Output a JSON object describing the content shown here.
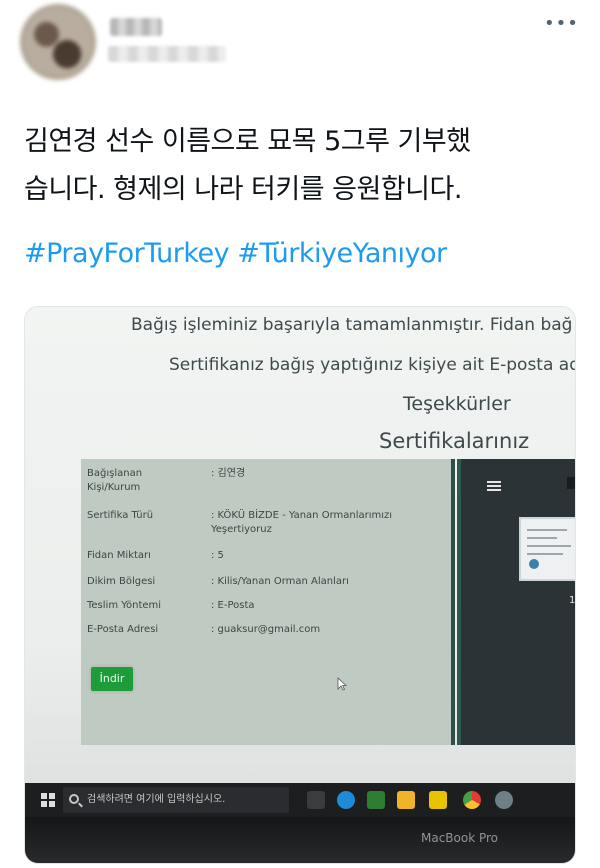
{
  "tweet": {
    "more_icon": "more-options-icon",
    "text_line1": "김연경 선수 이름으로 묘목 5그루 기부했",
    "text_line2": "습니다. 형제의 나라 터키를 응원합니다.",
    "hashtags": [
      "#PrayForTurkey",
      "#TürkiyeYanıyor"
    ]
  },
  "photo": {
    "screen_lines": [
      "Bağış işleminiz başarıyla tamamlanmıştır. Fidan bağ",
      "Sertifikanız bağış yaptığınız kişiye ait E-posta ad",
      "Teşekkürler",
      "Sertifikalarınız"
    ],
    "certificate": {
      "rows": [
        {
          "label": "Bağışlanan\nKişi/Kurum",
          "value": ": 김연경"
        },
        {
          "label": "Sertifika Türü",
          "value": ": KÖKÜ BİZDE - Yanan Ormanlarımızı\nYeşertiyoruz"
        },
        {
          "label": "Fidan Miktarı",
          "value": ": 5"
        },
        {
          "label": "Dikim Bölgesi",
          "value": ": Kilis/Yanan Orman Alanları"
        },
        {
          "label": "Teslim Yöntemi",
          "value": ": E-Posta"
        },
        {
          "label": "E-Posta Adresi",
          "value": ": guaksur@gmail.com"
        }
      ],
      "download_label": "İndir"
    },
    "side_panel": {
      "page_number": "1"
    },
    "taskbar": {
      "search_placeholder": "검색하려면 여기에 입력하십시오."
    },
    "bezel_label": "MacBook Pro"
  },
  "colors": {
    "hashtag": "#1d9bf0",
    "panel": "#bfcac2",
    "button": "#1f9c3a",
    "side_panel": "#2b3337"
  }
}
